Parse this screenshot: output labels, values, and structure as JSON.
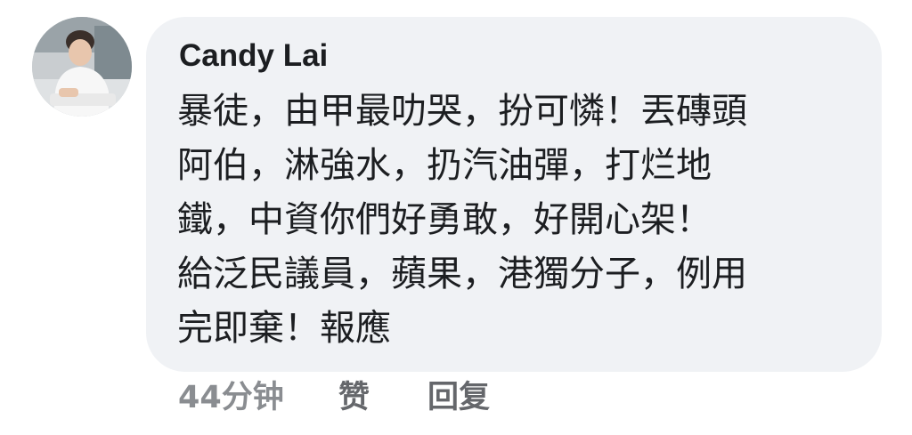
{
  "comment": {
    "author": "Candy Lai",
    "lines": [
      "暴徒，由甲最叻哭，扮可憐！丟磚頭",
      "阿伯，淋強水，扔汽油彈，打烂地",
      "鐵，中資你們好勇敢，好開心架！",
      "給泛民議員，蘋果，港獨分子，例用",
      "完即棄！報應"
    ],
    "timestamp": "44分钟",
    "like_label": "赞",
    "reply_label": "回复"
  },
  "colors": {
    "bubble_background": "#f0f2f5",
    "text": "#1c1e21",
    "action_text": "#65676b",
    "timestamp_text": "#8a8d91"
  },
  "icons": {
    "avatar": "profile-photo"
  }
}
